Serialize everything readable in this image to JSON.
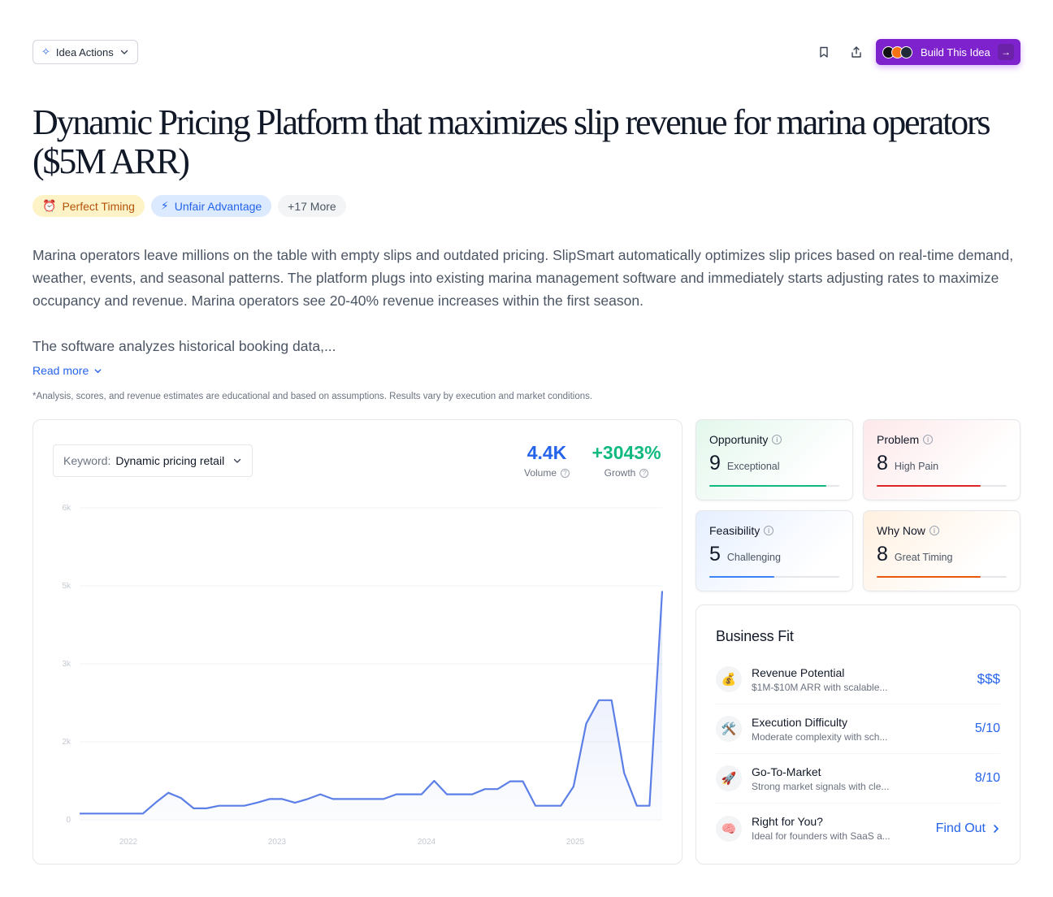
{
  "toolbar": {
    "idea_actions_label": "Idea Actions",
    "build_label": "Build This Idea"
  },
  "title": "Dynamic Pricing Platform that maximizes slip revenue for marina operators ($5M ARR)",
  "tags": [
    {
      "icon": "⏰",
      "label": "Perfect Timing"
    },
    {
      "icon": "⚡",
      "label": "Unfair Advantage"
    },
    {
      "label": "+17 More"
    }
  ],
  "description": {
    "p1": "Marina operators leave millions on the table with empty slips and outdated pricing. SlipSmart automatically optimizes slip prices based on real-time demand, weather, events, and seasonal patterns. The platform plugs into existing marina management software and immediately starts adjusting rates to maximize occupancy and revenue. Marina operators see 20-40% revenue increases within the first season.",
    "p2": "The software analyzes historical booking data,...",
    "read_more": "Read more"
  },
  "disclaimer": "*Analysis, scores, and revenue estimates are educational and based on assumptions. Results vary by execution and market conditions.",
  "trend": {
    "keyword_label": "Keyword:",
    "keyword_value": "Dynamic pricing retail",
    "volume_value": "4.4K",
    "volume_label": "Volume",
    "growth_value": "+3043%",
    "growth_label": "Growth"
  },
  "colors": {
    "line": "#5b7fe6",
    "volume": "#2563eb",
    "growth": "#10b981",
    "opportunity": "#10b981",
    "problem": "#dc2626",
    "feasibility": "#3b82f6",
    "why_now": "#ea580c"
  },
  "chart_data": {
    "type": "area",
    "y_ticks": [
      "0",
      "2k",
      "3k",
      "5k",
      "6k"
    ],
    "x_ticks": [
      "2022",
      "2023",
      "2024",
      "2025"
    ],
    "ylim": [
      0,
      6000
    ],
    "values": [
      120,
      120,
      120,
      120,
      120,
      120,
      330,
      520,
      420,
      220,
      220,
      270,
      270,
      270,
      330,
      400,
      400,
      330,
      400,
      490,
      400,
      400,
      400,
      400,
      400,
      490,
      490,
      490,
      750,
      490,
      490,
      490,
      590,
      590,
      740,
      740,
      270,
      270,
      270,
      640,
      1850,
      2300,
      2300,
      900,
      270,
      270,
      4400
    ]
  },
  "metrics": [
    {
      "title": "Opportunity",
      "score": "9",
      "label": "Exceptional",
      "value": 9
    },
    {
      "title": "Problem",
      "score": "8",
      "label": "High Pain",
      "value": 8
    },
    {
      "title": "Feasibility",
      "score": "5",
      "label": "Challenging",
      "value": 5
    },
    {
      "title": "Why Now",
      "score": "8",
      "label": "Great Timing",
      "value": 8
    }
  ],
  "business_fit": {
    "title": "Business Fit",
    "rows": [
      {
        "icon": "💰",
        "title": "Revenue Potential",
        "sub": "$1M-$10M ARR with scalable...",
        "value": "$$$"
      },
      {
        "icon": "🛠️",
        "title": "Execution Difficulty",
        "sub": "Moderate complexity with sch...",
        "value": "5/10"
      },
      {
        "icon": "🚀",
        "title": "Go-To-Market",
        "sub": "Strong market signals with cle...",
        "value": "8/10"
      },
      {
        "icon": "🧠",
        "title": "Right for You?",
        "sub": "Ideal for founders with SaaS a...",
        "value": "Find Out"
      }
    ]
  }
}
